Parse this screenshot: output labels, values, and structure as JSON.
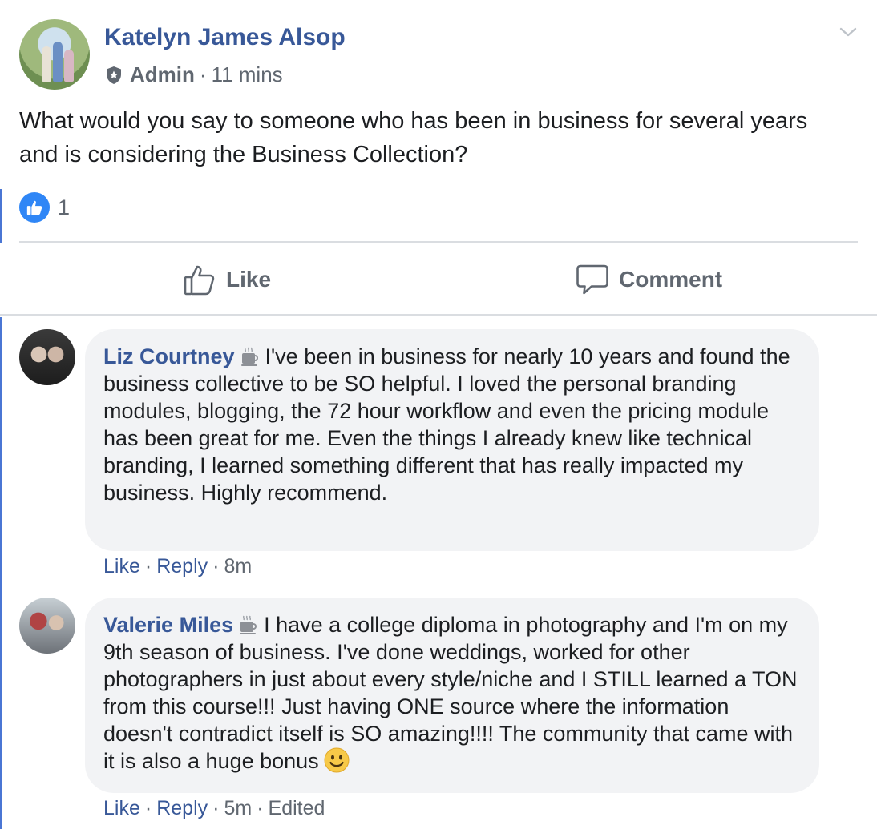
{
  "post": {
    "author": "Katelyn James Alsop",
    "role": "Admin",
    "time": "11 mins",
    "text": "What would you say to someone who has been in business for several years and is considering the Business Collection?",
    "reaction_count": "1"
  },
  "actions": {
    "like_label": "Like",
    "comment_label": "Comment"
  },
  "comments": [
    {
      "name": "Liz Courtney",
      "badge_icon": "coffee-cup-icon",
      "text": "I've been in business for nearly 10 years and found the business collective to be SO helpful. I loved the personal branding modules, blogging, the 72 hour workflow and even the pricing module has been great for me. Even the things I already knew like technical branding, I learned something different that has really impacted my business. Highly recommend.",
      "like": "Like",
      "reply": "Reply",
      "time": "8m"
    },
    {
      "name": "Valerie Miles",
      "badge_icon": "coffee-cup-icon",
      "text": "I have a college diploma in photography and I'm on my 9th season of business. I've done weddings, worked for other photographers in just about every style/niche and I STILL learned a TON from this course!!! Just having ONE source where the information doesn't contradict itself is SO amazing!!!! The community that came with it is also a huge bonus",
      "like": "Like",
      "reply": "Reply",
      "time": "5m",
      "edited": "Edited"
    }
  ],
  "colors": {
    "link_blue": "#385898",
    "like_blue": "#2f86f6",
    "muted": "#606770",
    "bubble_bg": "#f2f3f5"
  }
}
